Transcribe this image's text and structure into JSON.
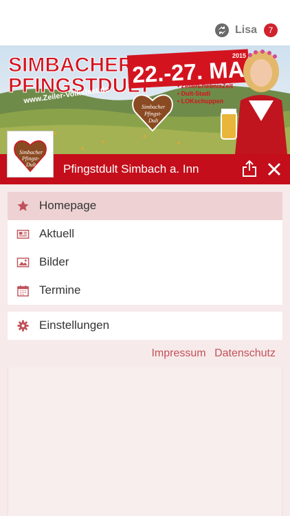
{
  "header": {
    "user_name": "Lisa",
    "notification_count": "7"
  },
  "banner": {
    "headline_line1": "SIMBACHER",
    "headline_line2": "PFINGSTDULT",
    "url": "www.Zeiler-Volksfest.de",
    "year": "2015",
    "dates": "22.-27. MAI",
    "venues": [
      "• ZeilerErlebnisZelt",
      "• Dult-Stadl",
      "• LOKschuppen"
    ],
    "heart_text": [
      "Simbacher",
      "Pfingst-",
      "Dult"
    ]
  },
  "titlebar": {
    "title": "Pfingstdult Simbach a. Inn"
  },
  "thumbnail": {
    "heart_text": [
      "Simbacher",
      "Pfingst-",
      "Dult"
    ]
  },
  "menu": {
    "items": [
      {
        "label": "Homepage",
        "icon": "star-icon",
        "active": true
      },
      {
        "label": "Aktuell",
        "icon": "newspaper-icon",
        "active": false
      },
      {
        "label": "Bilder",
        "icon": "image-icon",
        "active": false
      },
      {
        "label": "Termine",
        "icon": "calendar-icon",
        "active": false
      }
    ],
    "settings": {
      "label": "Einstellungen",
      "icon": "gear-icon"
    }
  },
  "footer_links": {
    "impressum": "Impressum",
    "datenschutz": "Datenschutz"
  },
  "colors": {
    "brand_red": "#c40e1b",
    "icon_red": "#c0525a",
    "active_bg": "#eed2d3",
    "page_bg": "#f7eaea"
  }
}
